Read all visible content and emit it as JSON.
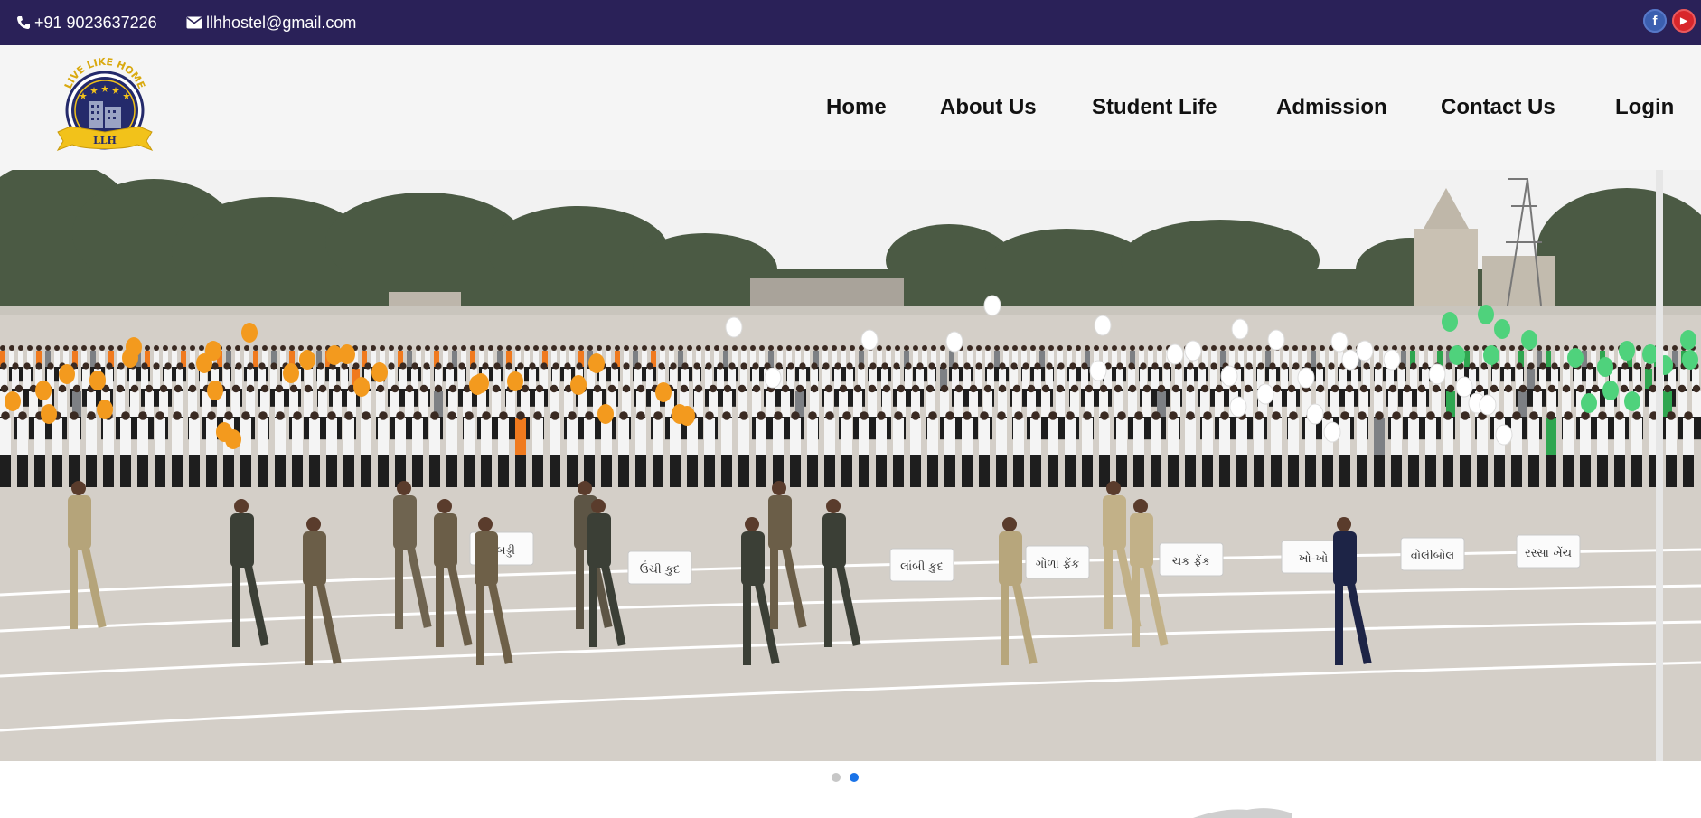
{
  "topbar": {
    "phone": "+91 9023637226",
    "email": "llhhostel@gmail.com",
    "phone_icon": "phone-icon",
    "email_icon": "envelope-icon",
    "social": [
      {
        "name": "facebook-icon",
        "glyph": "f",
        "color": "#3b5fb0"
      },
      {
        "name": "youtube-icon",
        "glyph": "▶",
        "color": "#d8262b"
      }
    ]
  },
  "logo": {
    "arc_text": "LIVE LIKE HOME",
    "ribbon_text": "LLH"
  },
  "nav": {
    "home": "Home",
    "about": "About Us",
    "student_life": "Student Life",
    "admission": "Admission",
    "contact": "Contact Us",
    "login": "Login"
  },
  "hero": {
    "signs": [
      "ઉંચી કુદ",
      "લાંબી કુદ",
      "ગોળા ફેંક",
      "ચક ફેંક",
      "ખો-ખો",
      "વોલીબોલ",
      "રસ્સા ખેંચ",
      "કબડ્ડી"
    ],
    "balloon_colors": {
      "orange": "#f39a1e",
      "white": "#ffffff",
      "green": "#4fd27c"
    },
    "sky_color": "#f2f2f2",
    "ground_color": "#d4cfc8"
  },
  "carousel": {
    "slide_count": 2,
    "active_index": 1,
    "active_color": "#1a73e8"
  },
  "colors": {
    "topbar_bg": "#2a2158",
    "header_bg": "#f5f5f5",
    "logo_navy": "#242a6b",
    "logo_gold": "#f2c21a"
  }
}
